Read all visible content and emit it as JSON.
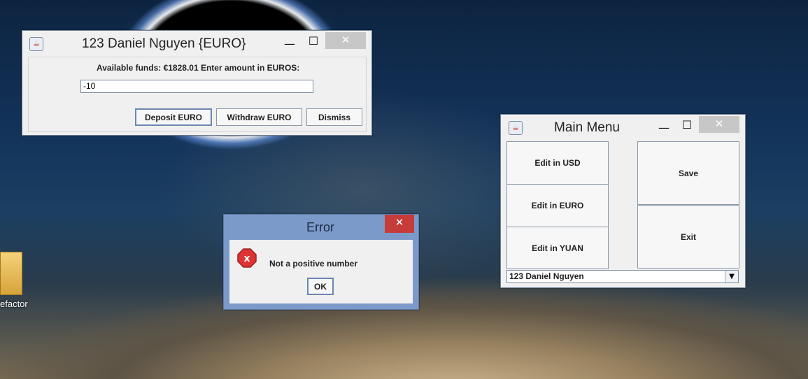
{
  "desktop": {
    "icon_label": "efactor"
  },
  "euro_window": {
    "title": "123 Daniel  Nguyen {EURO}",
    "prompt": "Available funds: €1828.01  Enter amount in EUROS:",
    "amount_value": "-10",
    "buttons": {
      "deposit": "Deposit EURO",
      "withdraw": "Withdraw EURO",
      "dismiss": "Dismiss"
    },
    "controls": {
      "minimize": "—",
      "maximize": "☐",
      "close": "✕"
    }
  },
  "main_menu": {
    "title": "Main Menu",
    "buttons": {
      "edit_usd": "Edit in USD",
      "edit_euro": "Edit in EURO",
      "edit_yuan": "Edit in YUAN",
      "save": "Save",
      "exit": "Exit"
    },
    "account_select": "123 Daniel  Nguyen",
    "controls": {
      "minimize": "—",
      "maximize": "☐",
      "close": "✕"
    }
  },
  "error_dialog": {
    "title": "Error",
    "message": "Not a positive number",
    "ok": "OK",
    "icon": "error-icon",
    "close": "✕"
  },
  "colors": {
    "error_title_bg": "#7b9ac9",
    "close_red": "#c83b3b"
  }
}
